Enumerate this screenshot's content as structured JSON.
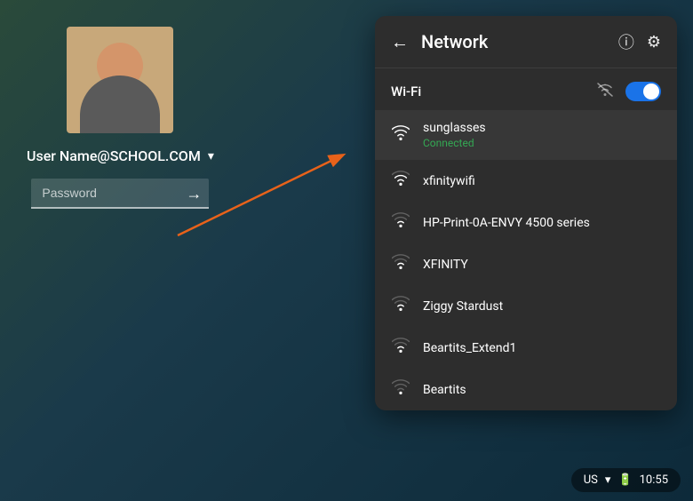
{
  "background": "#1a3a4a",
  "login": {
    "username": "User Name@SCHOOL.COM",
    "password_placeholder": "Password",
    "chevron": "▾",
    "submit_arrow": "→"
  },
  "network_panel": {
    "title": "Network",
    "back_icon": "←",
    "info_icon": "ⓘ",
    "settings_icon": "⚙",
    "wifi_label": "Wi-Fi",
    "wifi_toggle": true,
    "networks": [
      {
        "name": "sunglasses",
        "status": "Connected",
        "signal": 4,
        "connected": true
      },
      {
        "name": "xfinitywifi",
        "status": null,
        "signal": 3,
        "connected": false
      },
      {
        "name": "HP-Print-0A-ENVY 4500 series",
        "status": null,
        "signal": 2,
        "connected": false
      },
      {
        "name": "XFINITY",
        "status": null,
        "signal": 2,
        "connected": false
      },
      {
        "name": "Ziggy Stardust",
        "status": null,
        "signal": 2,
        "connected": false
      },
      {
        "name": "Beartits_Extend1",
        "status": null,
        "signal": 2,
        "connected": false
      },
      {
        "name": "Beartits",
        "status": null,
        "signal": 1,
        "connected": false
      }
    ]
  },
  "taskbar": {
    "region": "US",
    "time": "10:55"
  }
}
